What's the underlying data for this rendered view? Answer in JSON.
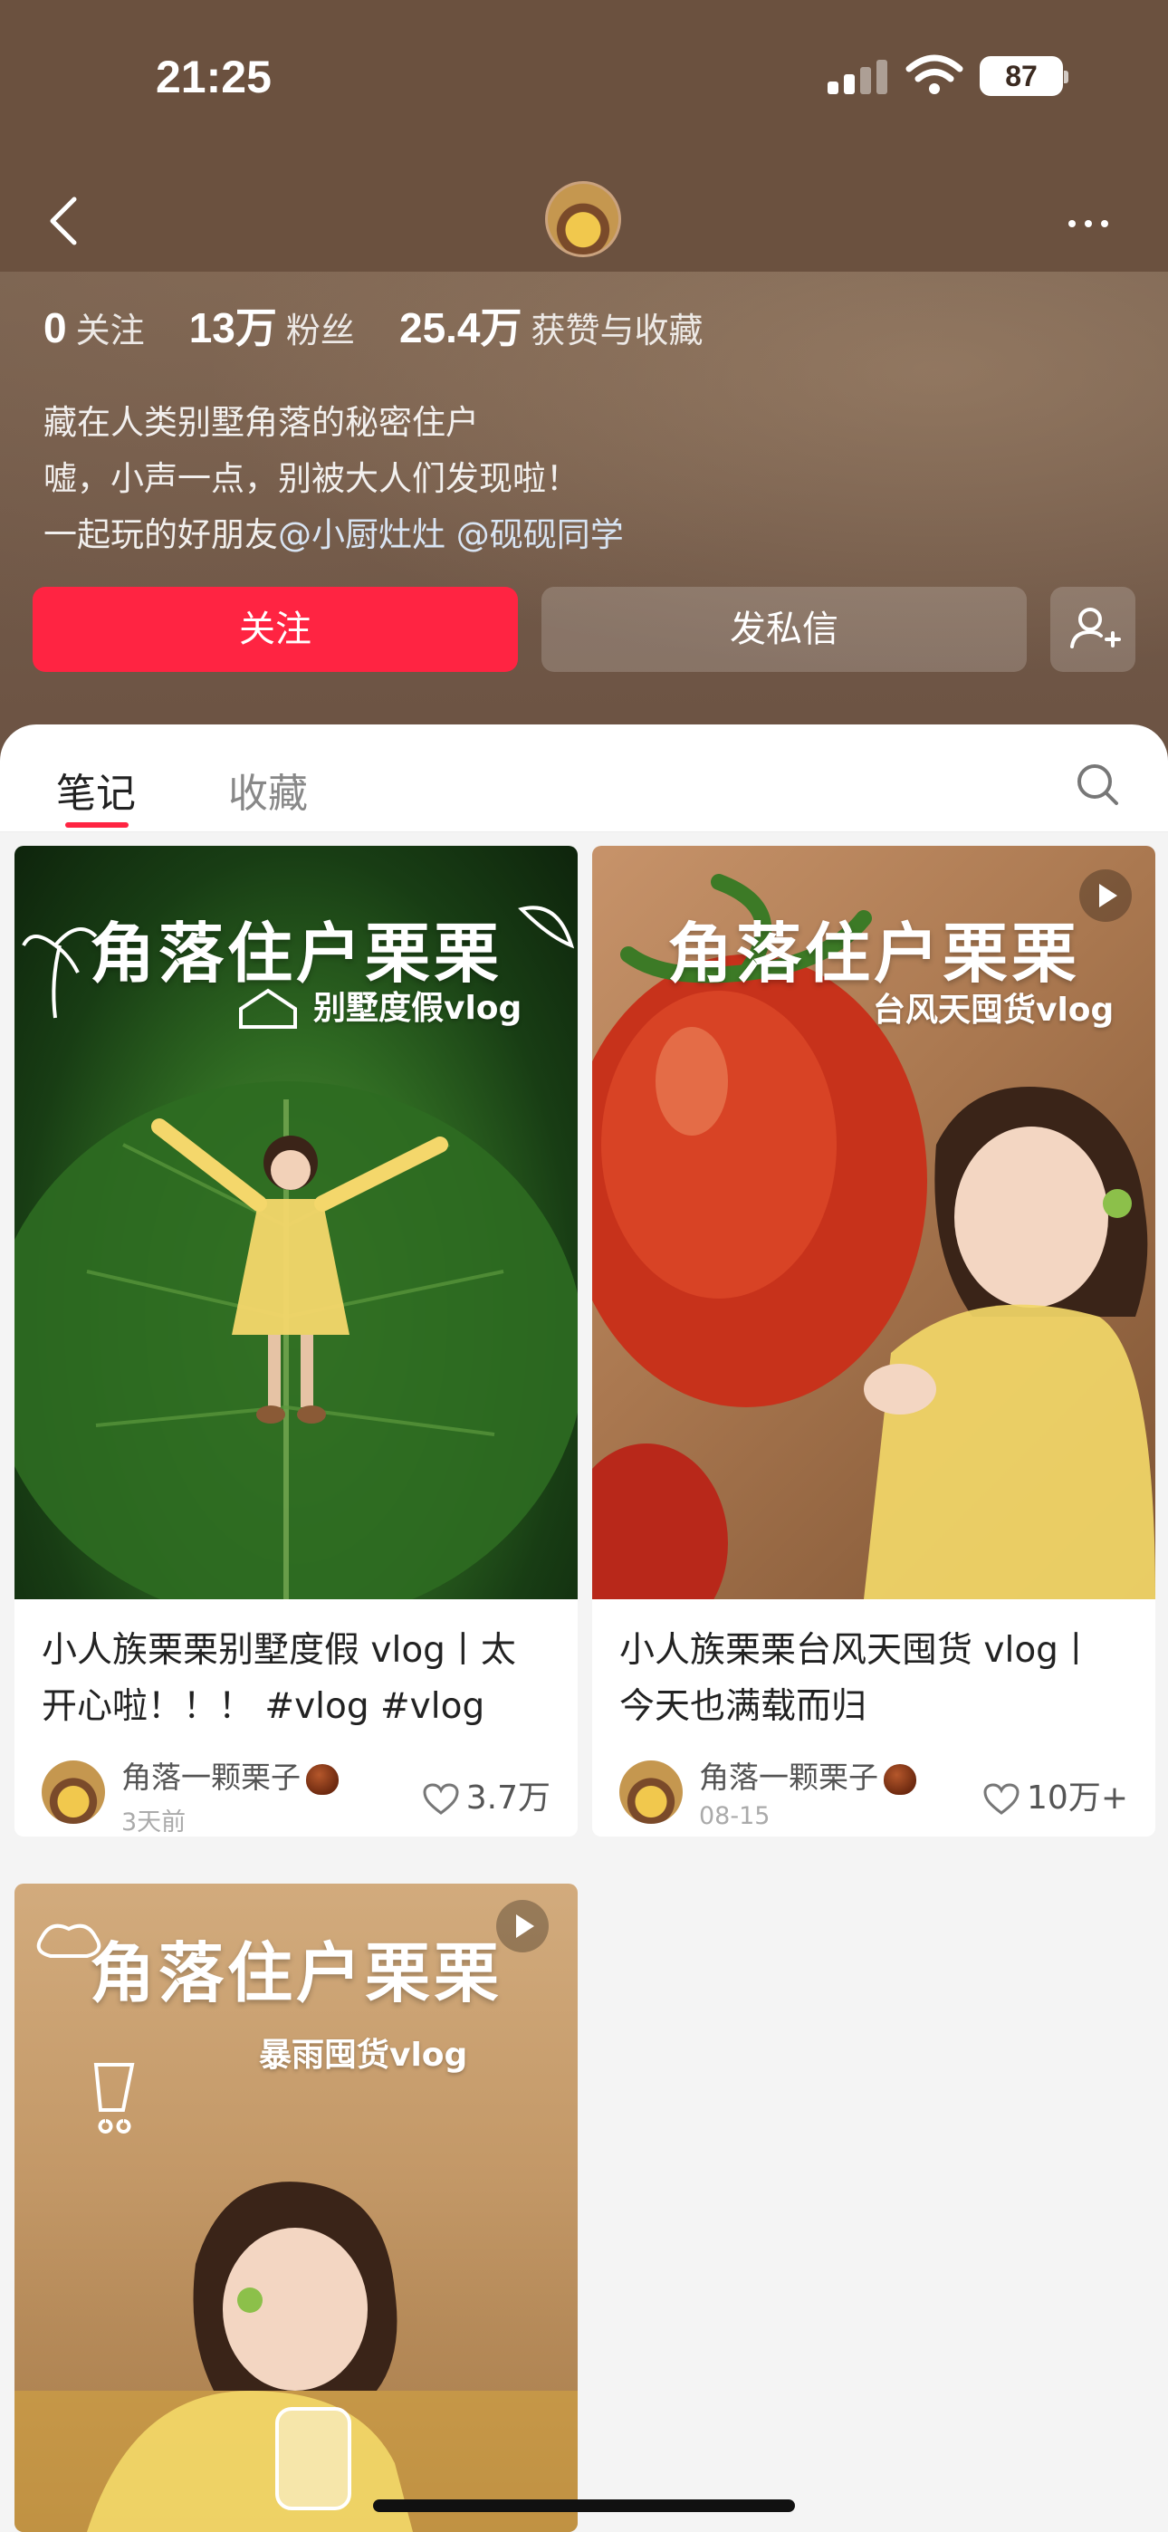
{
  "status": {
    "time": "21:25",
    "battery": "87"
  },
  "profile": {
    "following_count": "0",
    "following_label": "关注",
    "followers_count": "13万",
    "followers_label": "粉丝",
    "likes_count": "25.4万",
    "likes_label": "获赞与收藏",
    "bio_line1": "藏在人类别墅角落的秘密住户",
    "bio_line2": "嘘，小声一点，别被大人们发现啦！",
    "bio_line3_prefix": "一起玩的好朋友",
    "mention1": "@小厨灶灶",
    "mention2": "@砚砚同学"
  },
  "buttons": {
    "follow": "关注",
    "message": "发私信"
  },
  "tabs": [
    {
      "label": "笔记"
    },
    {
      "label": "收藏"
    }
  ],
  "notes": [
    {
      "cover_title": "角落住户栗栗",
      "cover_subtitle": "别墅度假vlog",
      "title": "小人族栗栗别墅度假 vlog丨太开心啦！！！ #vlog #vlog 日...",
      "author": "角落一颗栗子",
      "time": "3天前",
      "likes": "3.7万"
    },
    {
      "cover_title": "角落住户栗栗",
      "cover_subtitle": "台风天囤货vlog",
      "title": "小人族栗栗台风天囤货 vlog丨今天也满载而归",
      "author": "角落一颗栗子",
      "time": "08-15",
      "likes": "10万+"
    },
    {
      "cover_title": "角落住户栗栗",
      "cover_subtitle": "暴雨囤货vlog"
    }
  ],
  "colors": {
    "accent": "#ff2442",
    "header_bg": "#6b513f"
  }
}
